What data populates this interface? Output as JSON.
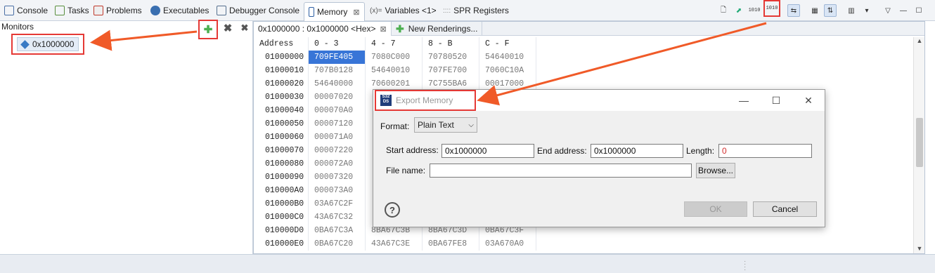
{
  "tabs": [
    {
      "label": "Console",
      "icon": "console-icon",
      "color": "#4a6fa5"
    },
    {
      "label": "Tasks",
      "icon": "tasks-icon",
      "color": "#5a8f3e"
    },
    {
      "label": "Problems",
      "icon": "problems-icon",
      "color": "#c0392b"
    },
    {
      "label": "Executables",
      "icon": "executables-icon",
      "color": "#3a6fb0"
    },
    {
      "label": "Debugger Console",
      "icon": "debugger-console-icon",
      "color": "#56708f"
    },
    {
      "label": "Memory",
      "icon": "memory-icon",
      "color": "#2d5fa3"
    },
    {
      "label": "Variables <1>",
      "icon": "variables-icon",
      "prefix": "(x)="
    },
    {
      "label": "SPR Registers",
      "icon": "spr-registers-icon",
      "prefix": "::::"
    }
  ],
  "toolbar": {
    "import_label": "1010",
    "export_label": "1010"
  },
  "monitors": {
    "title": "Monitors",
    "items": [
      {
        "label": "0x1000000"
      }
    ]
  },
  "rendering_tabs": [
    {
      "label": "0x1000000 : 0x1000000 <Hex>"
    },
    {
      "label": "New Renderings..."
    }
  ],
  "memory_table": {
    "headers": [
      "Address",
      "0 - 3",
      "4 - 7",
      "8 - B",
      "C - F"
    ],
    "rows": [
      [
        "01000000",
        "709FE405",
        "7080C000",
        "70780520",
        "54640010"
      ],
      [
        "01000010",
        "707B0128",
        "54640010",
        "707FE700",
        "7060C10A"
      ],
      [
        "01000020",
        "54640000",
        "70600201",
        "7C755BA6",
        "00017000"
      ],
      [
        "01000030",
        "00007020",
        "",
        "",
        ""
      ],
      [
        "01000040",
        "000070A0",
        "",
        "",
        ""
      ],
      [
        "01000050",
        "00007120",
        "",
        "",
        ""
      ],
      [
        "01000060",
        "000071A0",
        "",
        "",
        ""
      ],
      [
        "01000070",
        "00007220",
        "",
        "",
        ""
      ],
      [
        "01000080",
        "000072A0",
        "",
        "",
        ""
      ],
      [
        "01000090",
        "00007320",
        "",
        "",
        ""
      ],
      [
        "010000A0",
        "000073A0",
        "",
        "",
        ""
      ],
      [
        "010000B0",
        "03A67C2F",
        "",
        "",
        ""
      ],
      [
        "010000C0",
        "43A67C32",
        "",
        "",
        ""
      ],
      [
        "010000D0",
        "0BA67C3A",
        "8BA67C3B",
        "8BA67C3D",
        "0BA67C3F"
      ],
      [
        "010000E0",
        "0BA67C20",
        "43A67C3E",
        "0BA67FE8",
        "03A670A0"
      ]
    ]
  },
  "dialog": {
    "title": "Export Memory",
    "format_label": "Format:",
    "format_value": "Plain Text",
    "start_label": "Start address:",
    "start_value": "0x1000000",
    "end_label": "End address:",
    "end_value": "0x1000000",
    "length_label": "Length:",
    "length_value": "0",
    "file_label": "File name:",
    "file_value": "",
    "browse_label": "Browse...",
    "ok_label": "OK",
    "cancel_label": "Cancel"
  },
  "colors": {
    "highlight": "#e53935",
    "arrow": "#f05a28",
    "selection": "#3875d7"
  }
}
